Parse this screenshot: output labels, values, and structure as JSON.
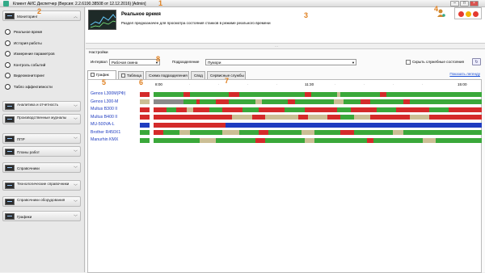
{
  "window": {
    "title": "Клиент АИС Диспетчер (Версия: 2.2.6190.38508 от 12.12.2016) [Admin]",
    "min": "–",
    "max": "□",
    "close": "×"
  },
  "markers": [
    "1",
    "2",
    "3",
    "4",
    "5",
    "6",
    "7",
    "8"
  ],
  "sidebar": {
    "monitoring": "Мониторинг",
    "subitems": [
      {
        "label": "Реальное время",
        "icon": "clock-icon"
      },
      {
        "label": "История работы",
        "icon": "history-icon"
      },
      {
        "label": "Измерение параметров",
        "icon": "gauge-icon"
      },
      {
        "label": "Контроль событий",
        "icon": "warning-icon"
      },
      {
        "label": "Видеомониторинг",
        "icon": "camera-icon"
      },
      {
        "label": "Табло эффективности",
        "icon": "scoreboard-icon"
      }
    ],
    "sections": [
      {
        "label": "Аналитика и отчетность"
      },
      {
        "label": "Производственные журналы"
      },
      {
        "label": "ППР"
      },
      {
        "label": "Планы работ"
      },
      {
        "label": "Справочники"
      },
      {
        "label": "Технологические справочники"
      },
      {
        "label": "Справочники оборудования"
      },
      {
        "label": "Графики"
      }
    ]
  },
  "header": {
    "title": "Реальное время",
    "description": "Раздел предназначен для просмотра состояния станков в режиме реального времени"
  },
  "settings": {
    "heading": "Настройки",
    "interval_label": "Интервал",
    "interval_value": "Рабочая смена",
    "division_label": "Подразделение",
    "division_value": "Пумори",
    "hide_service_label": "Скрыть служебные состояния"
  },
  "tabs": [
    {
      "label": "График",
      "checkbox": true,
      "active": true
    },
    {
      "label": "Таблица",
      "checkbox": true,
      "active": false
    },
    {
      "label": "Схема подразделения",
      "checkbox": false,
      "active": false
    },
    {
      "label": "Свод",
      "checkbox": false,
      "active": false
    },
    {
      "label": "Сервисные службы",
      "checkbox": false,
      "active": false
    }
  ],
  "legend_link": "Показать легенду",
  "time_ticks": [
    "8:00",
    "11:30",
    "15:00"
  ],
  "colors": {
    "green": "#3aa83a",
    "red": "#d42a2a",
    "tan": "#cbbf95",
    "blue": "#1f3cc0",
    "gray": "#8a8a8a"
  },
  "machines": [
    {
      "name": "Genos L300M(РФ)",
      "status": "red"
    },
    {
      "name": "Genos L300-M",
      "status": "tan"
    },
    {
      "name": "Multus B300 II",
      "status": "red"
    },
    {
      "name": "Multus B400 II",
      "status": "red"
    },
    {
      "name": "MU-500VA-L",
      "status": "blue"
    },
    {
      "name": "Brother R450X1",
      "status": "green"
    },
    {
      "name": "Manurhin KMX",
      "status": "green"
    }
  ],
  "timelines": [
    [
      [
        "green",
        0.09
      ],
      [
        "red",
        0.02
      ],
      [
        "green",
        0.12
      ],
      [
        "red",
        0.03
      ],
      [
        "green",
        0.2
      ],
      [
        "red",
        0.02
      ],
      [
        "green",
        0.08
      ],
      [
        "tan",
        0.01
      ],
      [
        "green",
        0.12
      ],
      [
        "red",
        0.02
      ],
      [
        "green",
        0.29
      ]
    ],
    [
      [
        "gray",
        0.09
      ],
      [
        "green",
        0.04
      ],
      [
        "red",
        0.01
      ],
      [
        "green",
        0.05
      ],
      [
        "red",
        0.04
      ],
      [
        "green",
        0.08
      ],
      [
        "tan",
        0.02
      ],
      [
        "green",
        0.08
      ],
      [
        "red",
        0.02
      ],
      [
        "green",
        0.12
      ],
      [
        "tan",
        0.03
      ],
      [
        "green",
        0.05
      ],
      [
        "red",
        0.03
      ],
      [
        "green",
        0.1
      ],
      [
        "red",
        0.02
      ],
      [
        "green",
        0.22
      ]
    ],
    [
      [
        "red",
        0.04
      ],
      [
        "green",
        0.03
      ],
      [
        "red",
        0.03
      ],
      [
        "tan",
        0.02
      ],
      [
        "red",
        0.05
      ],
      [
        "green",
        0.04
      ],
      [
        "red",
        0.06
      ],
      [
        "green",
        0.05
      ],
      [
        "red",
        0.08
      ],
      [
        "green",
        0.06
      ],
      [
        "red",
        0.1
      ],
      [
        "green",
        0.04
      ],
      [
        "red",
        0.08
      ],
      [
        "green",
        0.06
      ],
      [
        "red",
        0.1
      ],
      [
        "green",
        0.06
      ],
      [
        "red",
        0.1
      ]
    ],
    [
      [
        "red",
        0.24
      ],
      [
        "tan",
        0.06
      ],
      [
        "red",
        0.04
      ],
      [
        "tan",
        0.1
      ],
      [
        "red",
        0.03
      ],
      [
        "tan",
        0.06
      ],
      [
        "red",
        0.04
      ],
      [
        "green",
        0.04
      ],
      [
        "tan",
        0.05
      ],
      [
        "red",
        0.12
      ],
      [
        "tan",
        0.06
      ],
      [
        "red",
        0.16
      ]
    ],
    [
      [
        "red",
        0.22
      ],
      [
        "blue",
        0.78
      ]
    ],
    [
      [
        "red",
        0.03
      ],
      [
        "green",
        0.05
      ],
      [
        "tan",
        0.03
      ],
      [
        "green",
        0.1
      ],
      [
        "tan",
        0.05
      ],
      [
        "green",
        0.06
      ],
      [
        "red",
        0.03
      ],
      [
        "green",
        0.1
      ],
      [
        "tan",
        0.04
      ],
      [
        "green",
        0.08
      ],
      [
        "red",
        0.04
      ],
      [
        "green",
        0.12
      ],
      [
        "tan",
        0.03
      ],
      [
        "green",
        0.24
      ]
    ],
    [
      [
        "green",
        0.14
      ],
      [
        "tan",
        0.05
      ],
      [
        "green",
        0.12
      ],
      [
        "red",
        0.03
      ],
      [
        "green",
        0.12
      ],
      [
        "tan",
        0.03
      ],
      [
        "green",
        0.16
      ],
      [
        "red",
        0.02
      ],
      [
        "green",
        0.15
      ],
      [
        "tan",
        0.04
      ],
      [
        "green",
        0.14
      ]
    ]
  ]
}
